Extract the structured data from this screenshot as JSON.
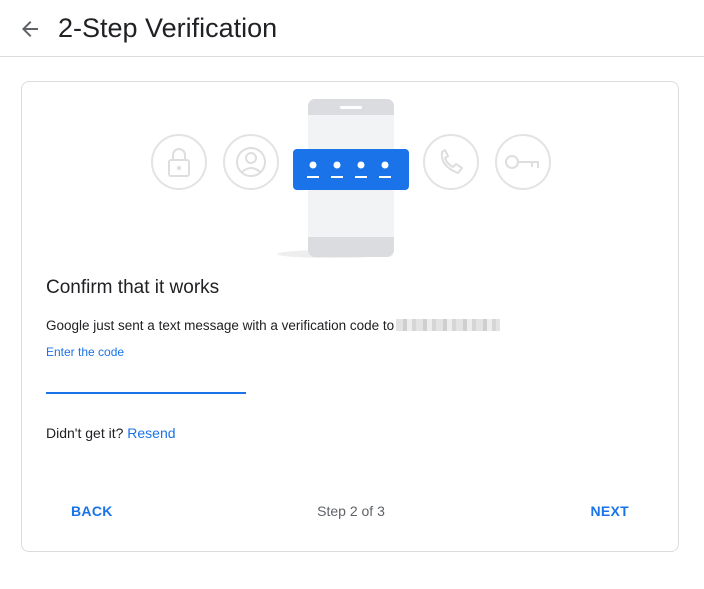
{
  "header": {
    "title": "2-Step Verification"
  },
  "card": {
    "heading": "Confirm that it works",
    "description": "Google just sent a text message with a verification code to",
    "code_label": "Enter the code",
    "code_value": "",
    "resend_prompt": "Didn't get it?",
    "resend_link": "Resend",
    "back_label": "BACK",
    "step_text": "Step 2 of 3",
    "next_label": "NEXT"
  },
  "illustration": {
    "icons": [
      "lock-icon",
      "account-icon",
      "phone-call-icon",
      "key-icon"
    ],
    "code_dots": 4
  },
  "colors": {
    "accent": "#1a73e8",
    "text": "#202124",
    "muted": "#5f6368",
    "border": "#dadce0"
  }
}
